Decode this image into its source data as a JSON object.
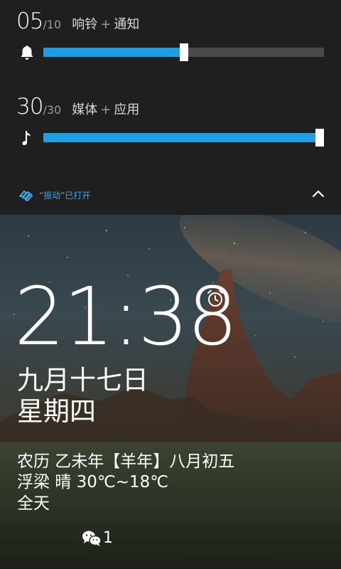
{
  "volume": {
    "ringer": {
      "level": "05",
      "max": "/10",
      "label_a": "响铃",
      "plus": "+",
      "label_b": "通知",
      "icon": "bell-icon",
      "fraction": 0.5
    },
    "media": {
      "level": "30",
      "max": "/30",
      "label_a": "媒体",
      "plus": "+",
      "label_b": "应用",
      "icon": "music-note-icon",
      "fraction": 1.0
    },
    "vibrate_text": "“振动”已打开",
    "vibrate_icon": "vibrate-icon",
    "collapse_icon": "chevron-up-icon"
  },
  "lockscreen": {
    "time": "21:38",
    "alarm_icon": "alarm-clock-icon",
    "date": "九月十七日",
    "weekday": "星期四",
    "lunar": "农历 乙未年【羊年】八月初五",
    "weather": "浮梁 晴 30℃~18℃",
    "allday": "全天",
    "notification": {
      "icon": "wechat-icon",
      "count": "1"
    }
  },
  "colors": {
    "accent": "#1e9fe3",
    "panel_bg": "#1f1f1f",
    "track": "#4a4a4a",
    "vibrate_text": "#3fa6e8"
  }
}
